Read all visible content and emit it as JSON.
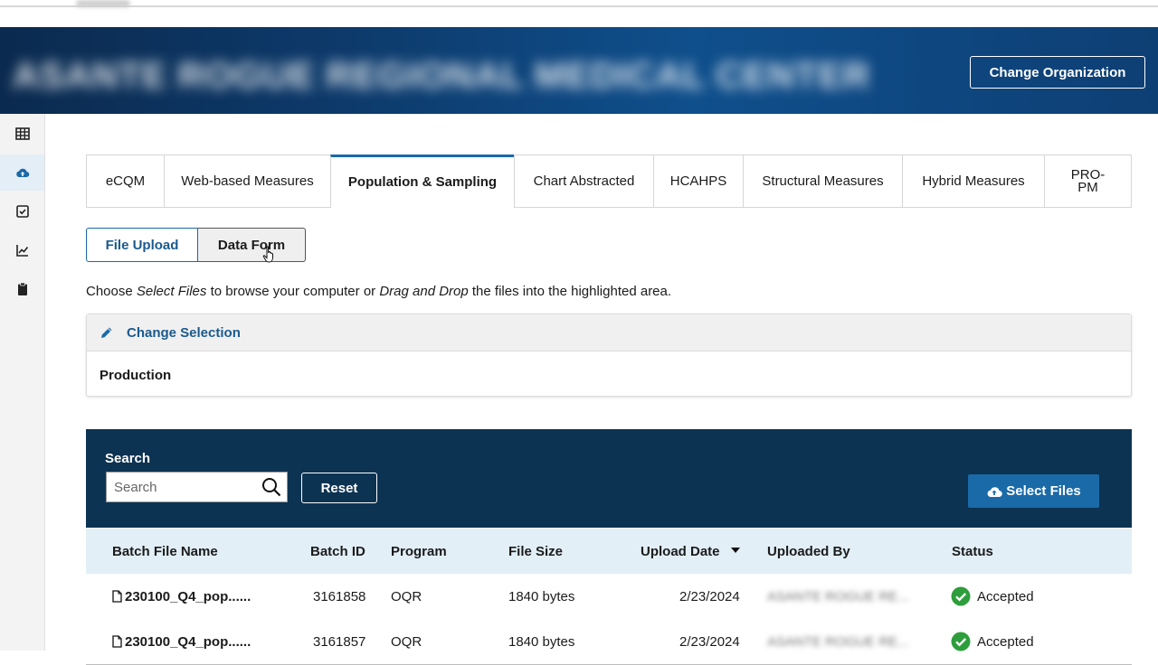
{
  "header": {
    "org_name": "ASANTE ROGUE REGIONAL MEDICAL CENTER",
    "change_org_label": "Change Organization"
  },
  "tabs": [
    {
      "label": "eCQM"
    },
    {
      "label": "Web-based Measures"
    },
    {
      "label": "Population & Sampling"
    },
    {
      "label": "Chart Abstracted"
    },
    {
      "label": "HCAHPS"
    },
    {
      "label": "Structural Measures"
    },
    {
      "label": "Hybrid Measures"
    },
    {
      "label": "PRO-PM"
    }
  ],
  "toggle": {
    "file_upload": "File Upload",
    "data_form": "Data Form"
  },
  "instructions": {
    "p1": "Choose ",
    "em1": "Select Files",
    "p2": " to browse your computer or ",
    "em2": "Drag and Drop",
    "p3": " the files into the highlighted area."
  },
  "selection": {
    "change_label": "Change Selection",
    "value": "Production"
  },
  "search": {
    "label": "Search",
    "placeholder": "Search",
    "reset_label": "Reset",
    "select_files_label": "Select Files"
  },
  "table": {
    "columns": {
      "name": "Batch File Name",
      "batch_id": "Batch ID",
      "program": "Program",
      "size": "File Size",
      "date": "Upload Date",
      "by": "Uploaded By",
      "status": "Status"
    },
    "rows": [
      {
        "name": "230100_Q4_pop......",
        "batch_id": "3161858",
        "program": "OQR",
        "size": "1840 bytes",
        "date": "2/23/2024",
        "by": "ASANTE ROGUE RE...",
        "status": "Accepted"
      },
      {
        "name": "230100_Q4_pop......",
        "batch_id": "3161857",
        "program": "OQR",
        "size": "1840 bytes",
        "date": "2/23/2024",
        "by": "ASANTE ROGUE RE...",
        "status": "Accepted"
      }
    ]
  },
  "colors": {
    "accent": "#1a69a8",
    "panel": "#0d3352",
    "success": "#2e9e3c"
  }
}
